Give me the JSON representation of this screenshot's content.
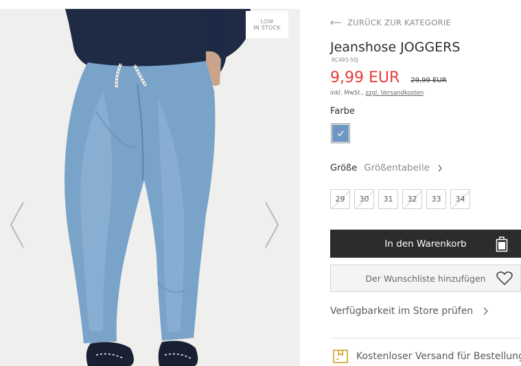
{
  "gallery": {
    "stock_badge_line1": "LOW",
    "stock_badge_line2": "IN STOCK",
    "prev_icon": "chevron-left-icon",
    "next_icon": "chevron-right-icon"
  },
  "product": {
    "back_label": "ZURÜCK ZUR KATEGORIE",
    "title": "Jeanshose JOGGERS",
    "sku": "RC493-50J",
    "price_new": "9,99 EUR",
    "price_old": "29,99 EUR",
    "tax_note_prefix": "inkl. MwSt.,",
    "tax_note_link": "zzgl. Versandkosten",
    "color_label": "Farbe",
    "color_swatch_hex": "#6d97c2",
    "size_label": "Größe",
    "size_chart_label": "Größentabelle",
    "sizes": [
      {
        "label": "29",
        "available": false
      },
      {
        "label": "30",
        "available": false
      },
      {
        "label": "31",
        "available": true
      },
      {
        "label": "32",
        "available": false
      },
      {
        "label": "33",
        "available": true
      },
      {
        "label": "34",
        "available": false
      }
    ],
    "cart_button": "In den Warenkorb",
    "wishlist_button": "Der Wunschliste hinzufügen",
    "store_check": "Verfügbarkeit im Store prüfen",
    "shipping_text": "Kostenloser Versand für Bestellungen"
  },
  "colors": {
    "price_red": "#e73a3a",
    "button_dark": "#2c2c2c"
  }
}
